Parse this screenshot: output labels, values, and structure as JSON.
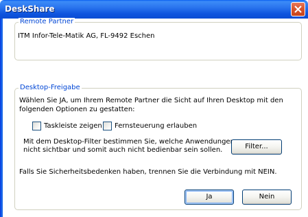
{
  "window": {
    "title": "DeskShare",
    "colors": {
      "titlebar": "#0e54de",
      "group_title": "#0046d5",
      "close": "#d9552e"
    }
  },
  "remote_partner": {
    "group_title": "Remote Partner",
    "name": "ITM Infor-Tele-Matik AG, FL-9492 Eschen"
  },
  "desktop_share": {
    "group_title": "Desktop-Freigabe",
    "intro_line1": "Wählen Sie JA, um Ihrem Remote Partner die Sicht auf Ihren Desktop mit den",
    "intro_line2": "folgenden Optionen zu gestatten:",
    "checkbox_taskbar": {
      "label": "Taskleiste zeigen",
      "checked": false
    },
    "checkbox_remote": {
      "label": "Fernsteuerung erlauben",
      "checked": false
    },
    "filter_line1": "Mit dem Desktop-Filter bestimmen Sie, welche Anwendungen",
    "filter_line2": "nicht sichtbar und somit auch nicht bedienbar sein sollen.",
    "filter_button": "Filter...",
    "security_note": "Falls Sie Sicherheitsbedenken haben, trennen Sie die Verbindung mit NEIN.",
    "yes_button": "Ja",
    "no_button": "Nein"
  }
}
